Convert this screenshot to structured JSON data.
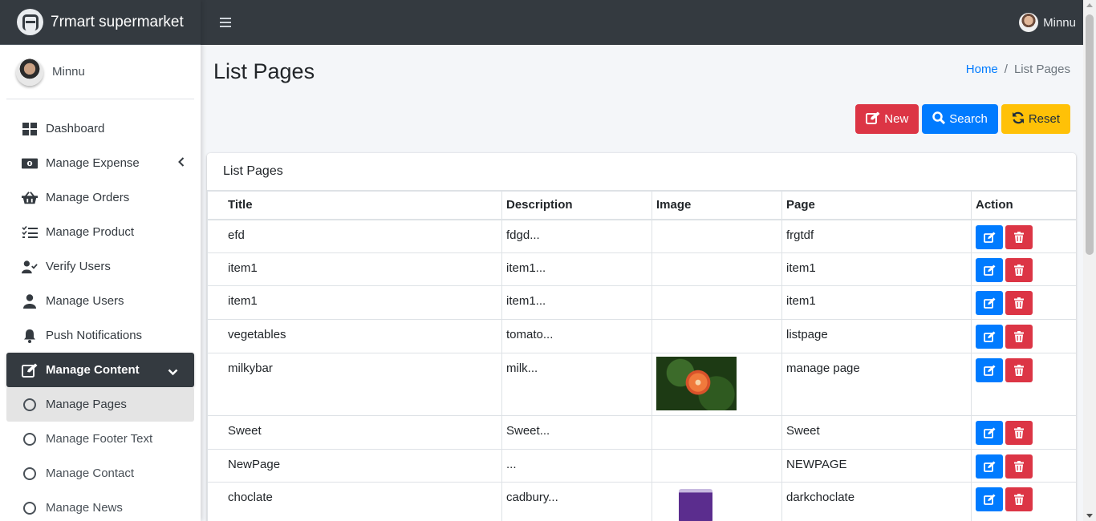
{
  "brand": {
    "name": "7rmart supermarket"
  },
  "user": {
    "name": "Minnu"
  },
  "sidebar": {
    "items": [
      {
        "label": "Dashboard",
        "icon": "dashboard-icon"
      },
      {
        "label": "Manage Expense",
        "icon": "money-icon"
      },
      {
        "label": "Manage Orders",
        "icon": "basket-icon"
      },
      {
        "label": "Manage Product",
        "icon": "tasks-icon"
      },
      {
        "label": "Verify Users",
        "icon": "user-check-icon"
      },
      {
        "label": "Manage Users",
        "icon": "user-icon"
      },
      {
        "label": "Push Notifications",
        "icon": "bell-icon"
      },
      {
        "label": "Manage Content",
        "icon": "edit-icon"
      },
      {
        "label": "Manage Pages",
        "icon": "circle-icon"
      },
      {
        "label": "Manage Footer Text",
        "icon": "circle-icon"
      },
      {
        "label": "Manage Contact",
        "icon": "circle-icon"
      },
      {
        "label": "Manage News",
        "icon": "circle-icon"
      }
    ]
  },
  "header": {
    "title": "List Pages",
    "breadcrumb": {
      "home": "Home",
      "separator": "/",
      "current": "List Pages"
    }
  },
  "toolbar": {
    "new_label": "New",
    "search_label": "Search",
    "reset_label": "Reset"
  },
  "card": {
    "title": "List Pages"
  },
  "table": {
    "columns": [
      "Title",
      "Description",
      "Image",
      "Page",
      "Action"
    ],
    "rows": [
      {
        "title": "efd",
        "description": "fdgd...",
        "page": "frgtdf"
      },
      {
        "title": "item1",
        "description": "item1...",
        "page": "item1"
      },
      {
        "title": "item1",
        "description": "item1...",
        "page": "item1"
      },
      {
        "title": "vegetables",
        "description": "tomato...",
        "page": "listpage"
      },
      {
        "title": "milkybar",
        "description": "milk...",
        "page": "manage page"
      },
      {
        "title": "Sweet",
        "description": "Sweet...",
        "page": "Sweet"
      },
      {
        "title": "NewPage",
        "description": "...",
        "page": "NEWPAGE"
      },
      {
        "title": "choclate",
        "description": "cadbury...",
        "page": "darkchoclate"
      }
    ]
  },
  "colors": {
    "navbar": "#343a40",
    "primary": "#007bff",
    "danger": "#dc3545",
    "warning": "#ffc107",
    "background": "#f4f6f9"
  }
}
